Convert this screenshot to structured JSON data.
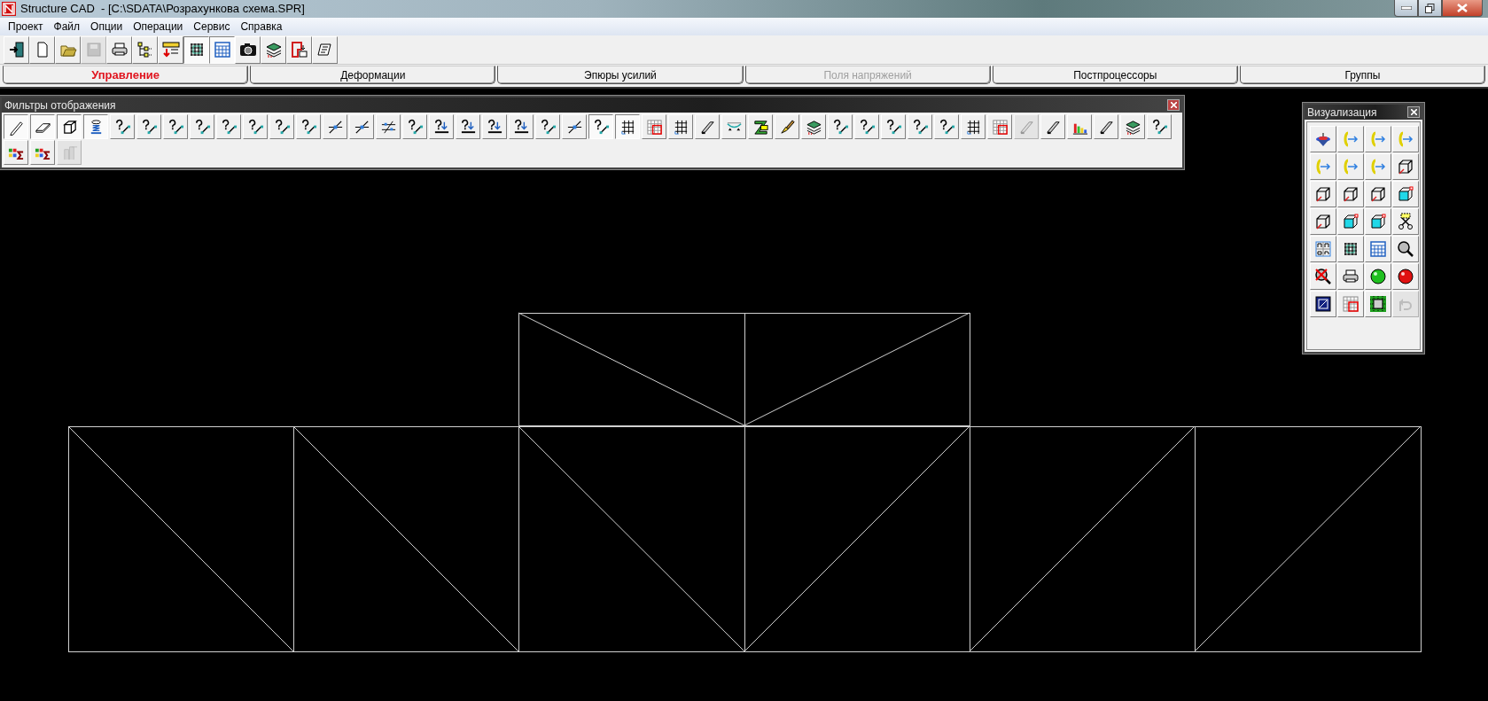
{
  "window": {
    "title": "Structure CAD  - [C:\\SDATA\\Розрахункова схема.SPR]"
  },
  "menu": [
    "Проект",
    "Файл",
    "Опции",
    "Операции",
    "Сервис",
    "Справка"
  ],
  "toolbar": [
    {
      "kind": "exit",
      "pressed": false,
      "disabled": false
    },
    {
      "kind": "page",
      "pressed": false,
      "disabled": false
    },
    {
      "kind": "folder",
      "pressed": false,
      "disabled": false
    },
    {
      "kind": "disk",
      "pressed": false,
      "disabled": true
    },
    {
      "kind": "printer",
      "pressed": false,
      "disabled": false
    },
    {
      "kind": "tree",
      "pressed": false,
      "disabled": false
    },
    {
      "kind": "ruler",
      "pressed": false,
      "disabled": false
    },
    {
      "kind": "mesh",
      "pressed": true,
      "disabled": false
    },
    {
      "kind": "table",
      "pressed": true,
      "disabled": false
    },
    {
      "kind": "camera",
      "pressed": false,
      "disabled": false
    },
    {
      "kind": "layers",
      "pressed": false,
      "disabled": false
    },
    {
      "kind": "frame",
      "pressed": false,
      "disabled": false
    },
    {
      "kind": "scroll",
      "pressed": false,
      "disabled": false
    }
  ],
  "tabs": [
    {
      "label": "Управление",
      "selected": true,
      "disabled": false
    },
    {
      "label": "Деформации",
      "selected": false,
      "disabled": false
    },
    {
      "label": "Эпюры усилий",
      "selected": false,
      "disabled": false
    },
    {
      "label": "Поля напряжений",
      "selected": false,
      "disabled": true
    },
    {
      "label": "Постпроцессоры",
      "selected": false,
      "disabled": false
    },
    {
      "label": "Группы",
      "selected": false,
      "disabled": false
    }
  ],
  "filter_panel": {
    "title": "Фильтры отображения",
    "buttons": [
      {
        "kind": "pencil",
        "pressed": true,
        "disabled": false
      },
      {
        "kind": "eraser",
        "pressed": true,
        "disabled": false
      },
      {
        "kind": "prism",
        "pressed": true,
        "disabled": false
      },
      {
        "kind": "spring",
        "pressed": true,
        "disabled": false
      },
      {
        "kind": "query",
        "pressed": false,
        "disabled": false
      },
      {
        "kind": "query",
        "pressed": false,
        "disabled": false
      },
      {
        "kind": "query",
        "pressed": false,
        "disabled": false
      },
      {
        "kind": "query",
        "pressed": false,
        "disabled": false
      },
      {
        "kind": "query",
        "pressed": false,
        "disabled": false
      },
      {
        "kind": "query",
        "pressed": false,
        "disabled": false
      },
      {
        "kind": "query",
        "pressed": false,
        "disabled": false
      },
      {
        "kind": "query",
        "pressed": false,
        "disabled": false
      },
      {
        "kind": "cross",
        "pressed": false,
        "disabled": false
      },
      {
        "kind": "cross",
        "pressed": false,
        "disabled": false
      },
      {
        "kind": "hatch",
        "pressed": false,
        "disabled": false
      },
      {
        "kind": "query",
        "pressed": false,
        "disabled": false
      },
      {
        "kind": "load",
        "pressed": false,
        "disabled": false
      },
      {
        "kind": "load",
        "pressed": false,
        "disabled": false
      },
      {
        "kind": "load",
        "pressed": false,
        "disabled": false
      },
      {
        "kind": "load",
        "pressed": false,
        "disabled": false
      },
      {
        "kind": "query",
        "pressed": false,
        "disabled": false
      },
      {
        "kind": "cross",
        "pressed": false,
        "disabled": false
      },
      {
        "kind": "query",
        "pressed": true,
        "disabled": false
      },
      {
        "kind": "grid",
        "pressed": true,
        "disabled": false
      },
      {
        "kind": "redgrid",
        "pressed": false,
        "disabled": false
      },
      {
        "kind": "grid",
        "pressed": false,
        "disabled": false
      },
      {
        "kind": "beam",
        "pressed": false,
        "disabled": false
      },
      {
        "kind": "curve",
        "pressed": false,
        "disabled": false
      },
      {
        "kind": "zbar",
        "pressed": false,
        "disabled": false
      },
      {
        "kind": "brush",
        "pressed": false,
        "disabled": false
      },
      {
        "kind": "layers",
        "pressed": false,
        "disabled": false
      },
      {
        "kind": "query",
        "pressed": false,
        "disabled": false
      },
      {
        "kind": "query",
        "pressed": false,
        "disabled": false
      },
      {
        "kind": "query",
        "pressed": false,
        "disabled": false
      },
      {
        "kind": "query",
        "pressed": false,
        "disabled": false
      },
      {
        "kind": "query",
        "pressed": false,
        "disabled": false
      },
      {
        "kind": "grid",
        "pressed": false,
        "disabled": false
      },
      {
        "kind": "redgrid",
        "pressed": false,
        "disabled": false
      },
      {
        "kind": "beam",
        "pressed": false,
        "disabled": true
      },
      {
        "kind": "beam",
        "pressed": false,
        "disabled": false
      },
      {
        "kind": "chart",
        "pressed": false,
        "disabled": false
      },
      {
        "kind": "beam",
        "pressed": false,
        "disabled": false
      },
      {
        "kind": "layers",
        "pressed": false,
        "disabled": false
      },
      {
        "kind": "query",
        "pressed": false,
        "disabled": false
      },
      {
        "kind": "sum",
        "pressed": false,
        "disabled": false
      },
      {
        "kind": "sum",
        "pressed": false,
        "disabled": false
      },
      {
        "kind": "tower",
        "pressed": false,
        "disabled": true
      }
    ]
  },
  "visualization_panel": {
    "title": "Визуализация",
    "buttons": [
      {
        "kind": "spin",
        "disabled": false
      },
      {
        "kind": "rotate",
        "disabled": false
      },
      {
        "kind": "rotate",
        "disabled": false
      },
      {
        "kind": "rotate",
        "disabled": false
      },
      {
        "kind": "rotate",
        "disabled": false
      },
      {
        "kind": "rotate",
        "disabled": false
      },
      {
        "kind": "rotate",
        "disabled": false
      },
      {
        "kind": "box",
        "disabled": false
      },
      {
        "kind": "box",
        "disabled": false
      },
      {
        "kind": "box",
        "disabled": false
      },
      {
        "kind": "box",
        "disabled": false
      },
      {
        "kind": "cube",
        "disabled": false
      },
      {
        "kind": "box",
        "disabled": false
      },
      {
        "kind": "cube",
        "disabled": false
      },
      {
        "kind": "cube",
        "disabled": false
      },
      {
        "kind": "scissors",
        "disabled": false
      },
      {
        "kind": "views",
        "disabled": false
      },
      {
        "kind": "mesh",
        "disabled": false
      },
      {
        "kind": "table",
        "disabled": false
      },
      {
        "kind": "magnifier",
        "disabled": false
      },
      {
        "kind": "nozoom",
        "disabled": false
      },
      {
        "kind": "printer",
        "disabled": false
      },
      {
        "kind": "greenball",
        "disabled": false
      },
      {
        "kind": "redball",
        "disabled": false
      },
      {
        "kind": "window",
        "disabled": false
      },
      {
        "kind": "redgrid",
        "disabled": false
      },
      {
        "kind": "greengrid",
        "disabled": false
      },
      {
        "kind": "undo",
        "disabled": true
      }
    ]
  }
}
